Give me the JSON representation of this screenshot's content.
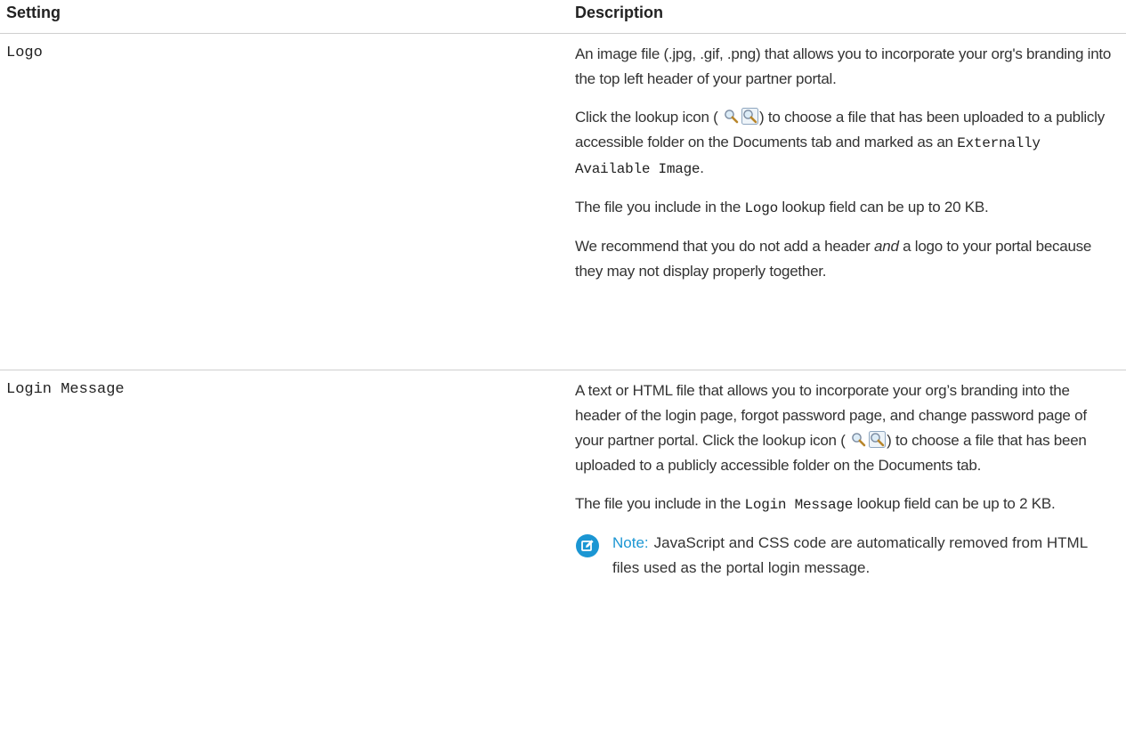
{
  "headers": {
    "setting": "Setting",
    "description": "Description"
  },
  "rows": [
    {
      "setting": "Logo",
      "p1": "An image file (.jpg, .gif, .png) that allows you to incorporate your org's branding into the top left header of your partner portal.",
      "p2_pre": "Click the lookup icon (",
      "p2_post": ") to choose a file that has been uploaded to a publicly accessible folder on the Documents tab and marked as an ",
      "p2_code": "Externally Available Image",
      "p2_end": ".",
      "p3_pre": "The file you include in the ",
      "p3_code": "Logo",
      "p3_post": " lookup field can be up to 20 KB.",
      "p4_pre": "We recommend that you do not add a header ",
      "p4_em": "and",
      "p4_post": " a logo to your portal because they may not display properly together."
    },
    {
      "setting": "Login Message",
      "p1_pre": "A text or HTML file that allows you to incorporate your org’s branding into the header of the login page, forgot password page, and change password page of your partner portal. Click the lookup icon (",
      "p1_post": ") to choose a file that has been uploaded to a publicly accessible folder on the Documents tab.",
      "p2_pre": "The file you include in the ",
      "p2_code": "Login Message",
      "p2_post": " lookup field can be up to 2 KB.",
      "note_label": "Note:",
      "note_text": "JavaScript and CSS code are automatically removed from HTML files used as the portal login message."
    }
  ],
  "icons": {
    "lookup": "lookup-icon",
    "note": "note-icon"
  },
  "colors": {
    "note_accent": "#1b96d3",
    "divider": "#cfcfcf"
  }
}
